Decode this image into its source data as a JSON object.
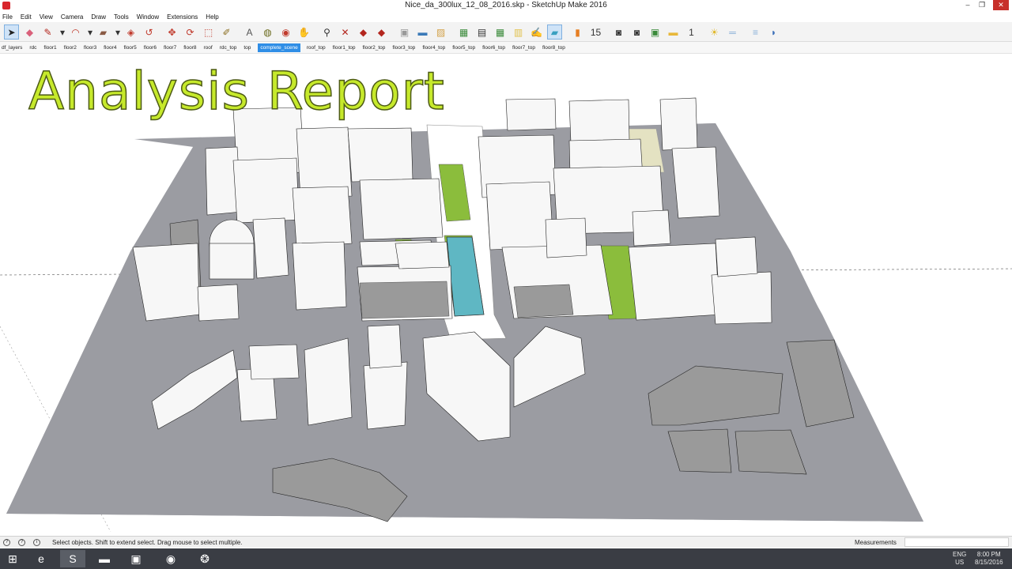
{
  "window": {
    "title": "Nice_da_300lux_12_08_2016.skp - SketchUp Make 2016",
    "controls": [
      "–",
      "❐",
      "✕"
    ]
  },
  "menu": [
    "File",
    "Edit",
    "View",
    "Camera",
    "Draw",
    "Tools",
    "Window",
    "Extensions",
    "Help"
  ],
  "toolbar": [
    {
      "name": "select-tool",
      "glyph": "➤",
      "color": "#222222",
      "active": true
    },
    {
      "name": "eraser-tool",
      "glyph": "◆",
      "color": "#d9607a"
    },
    {
      "name": "pencil-line-tool",
      "glyph": "✎",
      "color": "#b3261e"
    },
    {
      "name": "line-dropdown",
      "glyph": "▾",
      "color": "#333333"
    },
    {
      "name": "arc-tool",
      "glyph": "◠",
      "color": "#c0392b"
    },
    {
      "name": "arc-dropdown",
      "glyph": "▾",
      "color": "#333333"
    },
    {
      "name": "rectangle-tool",
      "glyph": "▰",
      "color": "#8a5a44"
    },
    {
      "name": "shape-dropdown",
      "glyph": "▾",
      "color": "#333333"
    },
    {
      "name": "push-pull-tool",
      "glyph": "◈",
      "color": "#c0392b"
    },
    {
      "name": "follow-me-tool",
      "glyph": "↺",
      "color": "#c0392b"
    },
    {
      "name": "move-tool",
      "glyph": "✥",
      "color": "#c0392b"
    },
    {
      "name": "rotate-tool",
      "glyph": "⟳",
      "color": "#c0392b"
    },
    {
      "name": "scale-tool",
      "glyph": "⬚",
      "color": "#c0392b"
    },
    {
      "name": "tape-measure-tool",
      "glyph": "✐",
      "color": "#8a6d1e"
    },
    {
      "name": "text-tool",
      "glyph": "A",
      "color": "#555555"
    },
    {
      "name": "paint-bucket-tool",
      "glyph": "◍",
      "color": "#6b6b1e"
    },
    {
      "name": "orbit-tool",
      "glyph": "◉",
      "color": "#c0392b"
    },
    {
      "name": "pan-tool",
      "glyph": "✋",
      "color": "#c79a3a"
    },
    {
      "name": "zoom-tool",
      "glyph": "⚲",
      "color": "#333333"
    },
    {
      "name": "zoom-extents-tool",
      "glyph": "✕",
      "color": "#b3261e"
    },
    {
      "name": "warehouse-tool",
      "glyph": "◆",
      "color": "#b3261e"
    },
    {
      "name": "components-tool",
      "glyph": "◆",
      "color": "#b3261e"
    },
    {
      "name": "extension-tool",
      "glyph": "▣",
      "color": "#999999"
    },
    {
      "name": "shadow-settings-tool",
      "glyph": "▬",
      "color": "#3b7ab8"
    },
    {
      "name": "materials-tool",
      "glyph": "▨",
      "color": "#d3a24a"
    },
    {
      "name": "outliner-tool",
      "glyph": "▦",
      "color": "#3a8a3a"
    },
    {
      "name": "layers-tool",
      "glyph": "▤",
      "color": "#333333"
    },
    {
      "name": "scenes-tool",
      "glyph": "▦",
      "color": "#3a8a3a"
    },
    {
      "name": "notes-tool",
      "glyph": "▥",
      "color": "#e1c14b"
    },
    {
      "name": "brush-tool",
      "glyph": "✍",
      "color": "#c79a3a"
    },
    {
      "name": "false-color-tool",
      "glyph": "▰",
      "color": "#3aa0c0",
      "active": true
    },
    {
      "name": "color-scale-tool",
      "glyph": "▮",
      "color": "#e67e22"
    },
    {
      "name": "grid-15-tool",
      "glyph": "15",
      "color": "#333333"
    },
    {
      "name": "camera-tool",
      "glyph": "◙",
      "color": "#333333"
    },
    {
      "name": "render-camera-tool",
      "glyph": "◙",
      "color": "#333333"
    },
    {
      "name": "export-tool",
      "glyph": "▣",
      "color": "#3a8a3a"
    },
    {
      "name": "folder-tool",
      "glyph": "▬",
      "color": "#e8b83a"
    },
    {
      "name": "one-tool",
      "glyph": "1",
      "color": "#333333"
    },
    {
      "name": "sun-tool",
      "glyph": "☀",
      "color": "#e1b82a"
    },
    {
      "name": "section-plane-tool",
      "glyph": "═",
      "color": "#8ab0d8"
    },
    {
      "name": "section-cut-tool",
      "glyph": "≡",
      "color": "#8ab0d8"
    },
    {
      "name": "tag-tool",
      "glyph": "◗",
      "color": "#3b6fb8"
    }
  ],
  "scenes": [
    {
      "label": "df_layers"
    },
    {
      "label": "rdc"
    },
    {
      "label": "floor1"
    },
    {
      "label": "floor2"
    },
    {
      "label": "floor3"
    },
    {
      "label": "floor4"
    },
    {
      "label": "floor5"
    },
    {
      "label": "floor6"
    },
    {
      "label": "floor7"
    },
    {
      "label": "floor8"
    },
    {
      "label": "roof"
    },
    {
      "label": "rdc_top"
    },
    {
      "label": "top"
    },
    {
      "label": "complete_scene",
      "active": true
    },
    {
      "label": "roof_top"
    },
    {
      "label": "floor1_top"
    },
    {
      "label": "floor2_top"
    },
    {
      "label": "floor3_top"
    },
    {
      "label": "floor4_top"
    },
    {
      "label": "floor5_top"
    },
    {
      "label": "floor6_top"
    },
    {
      "label": "floor7_top"
    },
    {
      "label": "floor8_top"
    }
  ],
  "viewport": {
    "overlay_title": "Analysis Report",
    "colors": {
      "ground": "#9b9ca2",
      "building_fill": "#f7f7f7",
      "building_side": "#9a9a9a",
      "grass": "#8bbd3c",
      "water": "#5fb7c3",
      "path": "#ffffff",
      "sand": "#e4e2c2",
      "title_text": "#c6e92b"
    }
  },
  "status": {
    "icons": [
      "?",
      "?",
      "i"
    ],
    "message": "Select objects. Shift to extend select. Drag mouse to select multiple.",
    "measurements_label": "Measurements",
    "measurements_value": ""
  },
  "taskbar": {
    "apps": [
      {
        "name": "start-button",
        "glyph": "⊞"
      },
      {
        "name": "internet-explorer-app",
        "glyph": "e"
      },
      {
        "name": "sketchup-app",
        "glyph": "S",
        "active": true
      },
      {
        "name": "file-explorer-app",
        "glyph": "▬"
      },
      {
        "name": "command-prompt-app",
        "glyph": "▣"
      },
      {
        "name": "firefox-app",
        "glyph": "◉"
      },
      {
        "name": "app-icon-7",
        "glyph": "❂"
      }
    ],
    "lang_top": "ENG",
    "lang_bottom": "US",
    "time": "8:00 PM",
    "date": "8/15/2016"
  }
}
